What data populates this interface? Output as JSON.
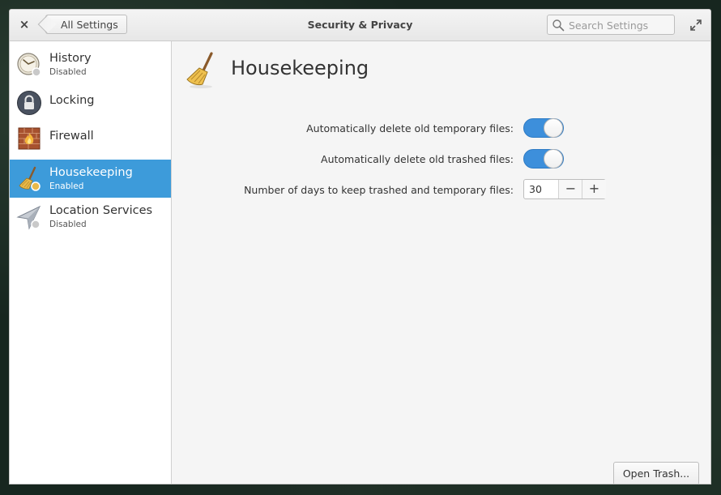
{
  "window": {
    "title": "Security & Privacy",
    "back_label": "All Settings",
    "search_placeholder": "Search Settings",
    "close_glyph": "×"
  },
  "sidebar": {
    "items": [
      {
        "name": "History",
        "status": "Disabled",
        "icon": "history-icon",
        "selected": false
      },
      {
        "name": "Locking",
        "status": "",
        "icon": "lock-icon",
        "selected": false
      },
      {
        "name": "Firewall",
        "status": "",
        "icon": "firewall-icon",
        "selected": false
      },
      {
        "name": "Housekeeping",
        "status": "Enabled",
        "icon": "broom-icon",
        "selected": true
      },
      {
        "name": "Location Services",
        "status": "Disabled",
        "icon": "location-icon",
        "selected": false
      }
    ]
  },
  "page": {
    "title": "Housekeeping",
    "icon": "broom-icon",
    "rows": [
      {
        "label": "Automatically delete old temporary files:",
        "control": "toggle",
        "on": true
      },
      {
        "label": "Automatically delete old trashed files:",
        "control": "toggle",
        "on": true
      },
      {
        "label": "Number of days to keep trashed and temporary files:",
        "control": "spinbutton",
        "value": "30",
        "minus": "−",
        "plus": "+"
      }
    ],
    "open_trash_label": "Open Trash..."
  },
  "colors": {
    "accent": "#3d9bda",
    "toggle_on": "#3d8fdb"
  }
}
